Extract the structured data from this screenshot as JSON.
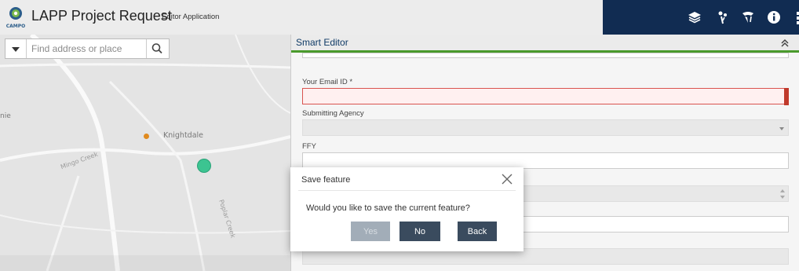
{
  "header": {
    "logo_text": "CAMPO",
    "title": "LAPP Project Request",
    "subtitle": "Editor Application",
    "colors": {
      "bar": "#ececec",
      "nav": "#112c52"
    },
    "icons": [
      "layers-icon",
      "legend-icon",
      "basemap-icon",
      "info-icon"
    ]
  },
  "map": {
    "search": {
      "placeholder": "Find address or place",
      "value": ""
    },
    "labels": {
      "town": "Knightdale",
      "creek": "Mingo Creek",
      "road": "Poplar Creek",
      "edge": "nie"
    },
    "colors": {
      "place_marker": "#e08a1e",
      "feature_marker": "#3cc491"
    }
  },
  "smart_editor": {
    "title": "Smart Editor",
    "accent_color": "#4a9a2c",
    "fields": [
      {
        "label": "Your Email ID *",
        "value": "",
        "state": "error"
      },
      {
        "label": "Submitting Agency",
        "value": "",
        "control": "select"
      },
      {
        "label": "FFY",
        "value": ""
      }
    ]
  },
  "dialog": {
    "title": "Save feature",
    "message": "Would you like to save the current feature?",
    "buttons": {
      "yes": "Yes",
      "no": "No",
      "back": "Back"
    },
    "yes_enabled": false
  }
}
